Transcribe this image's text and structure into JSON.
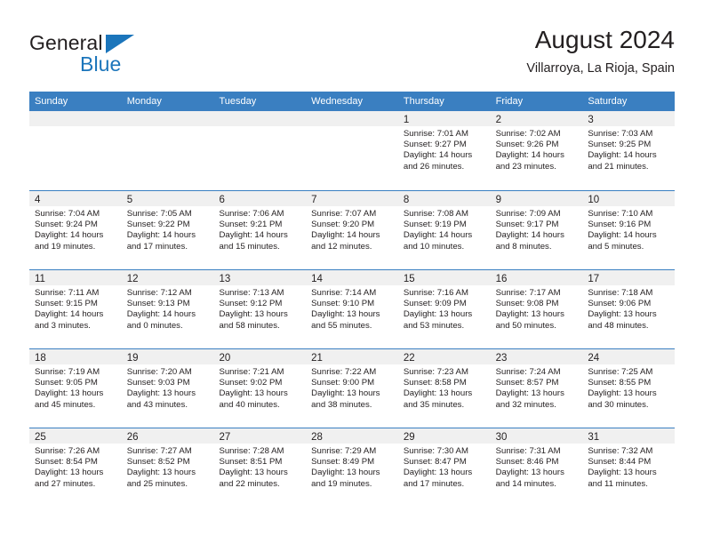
{
  "brand": {
    "name_part1": "General",
    "name_part2": "Blue",
    "triangle_icon": "triangle-icon",
    "accent_color": "#1b75bb"
  },
  "header": {
    "title": "August 2024",
    "subtitle": "Villarroya, La Rioja, Spain"
  },
  "calendar": {
    "header_color": "#3a7fc1",
    "weekday_headers": [
      "Sunday",
      "Monday",
      "Tuesday",
      "Wednesday",
      "Thursday",
      "Friday",
      "Saturday"
    ],
    "weeks": [
      [
        {
          "day": "",
          "sunrise": "",
          "sunset": "",
          "daylight_line1": "",
          "daylight_line2": "",
          "empty": true
        },
        {
          "day": "",
          "sunrise": "",
          "sunset": "",
          "daylight_line1": "",
          "daylight_line2": "",
          "empty": true
        },
        {
          "day": "",
          "sunrise": "",
          "sunset": "",
          "daylight_line1": "",
          "daylight_line2": "",
          "empty": true
        },
        {
          "day": "",
          "sunrise": "",
          "sunset": "",
          "daylight_line1": "",
          "daylight_line2": "",
          "empty": true
        },
        {
          "day": "1",
          "sunrise": "Sunrise: 7:01 AM",
          "sunset": "Sunset: 9:27 PM",
          "daylight_line1": "Daylight: 14 hours",
          "daylight_line2": "and 26 minutes."
        },
        {
          "day": "2",
          "sunrise": "Sunrise: 7:02 AM",
          "sunset": "Sunset: 9:26 PM",
          "daylight_line1": "Daylight: 14 hours",
          "daylight_line2": "and 23 minutes."
        },
        {
          "day": "3",
          "sunrise": "Sunrise: 7:03 AM",
          "sunset": "Sunset: 9:25 PM",
          "daylight_line1": "Daylight: 14 hours",
          "daylight_line2": "and 21 minutes."
        }
      ],
      [
        {
          "day": "4",
          "sunrise": "Sunrise: 7:04 AM",
          "sunset": "Sunset: 9:24 PM",
          "daylight_line1": "Daylight: 14 hours",
          "daylight_line2": "and 19 minutes."
        },
        {
          "day": "5",
          "sunrise": "Sunrise: 7:05 AM",
          "sunset": "Sunset: 9:22 PM",
          "daylight_line1": "Daylight: 14 hours",
          "daylight_line2": "and 17 minutes."
        },
        {
          "day": "6",
          "sunrise": "Sunrise: 7:06 AM",
          "sunset": "Sunset: 9:21 PM",
          "daylight_line1": "Daylight: 14 hours",
          "daylight_line2": "and 15 minutes."
        },
        {
          "day": "7",
          "sunrise": "Sunrise: 7:07 AM",
          "sunset": "Sunset: 9:20 PM",
          "daylight_line1": "Daylight: 14 hours",
          "daylight_line2": "and 12 minutes."
        },
        {
          "day": "8",
          "sunrise": "Sunrise: 7:08 AM",
          "sunset": "Sunset: 9:19 PM",
          "daylight_line1": "Daylight: 14 hours",
          "daylight_line2": "and 10 minutes."
        },
        {
          "day": "9",
          "sunrise": "Sunrise: 7:09 AM",
          "sunset": "Sunset: 9:17 PM",
          "daylight_line1": "Daylight: 14 hours",
          "daylight_line2": "and 8 minutes."
        },
        {
          "day": "10",
          "sunrise": "Sunrise: 7:10 AM",
          "sunset": "Sunset: 9:16 PM",
          "daylight_line1": "Daylight: 14 hours",
          "daylight_line2": "and 5 minutes."
        }
      ],
      [
        {
          "day": "11",
          "sunrise": "Sunrise: 7:11 AM",
          "sunset": "Sunset: 9:15 PM",
          "daylight_line1": "Daylight: 14 hours",
          "daylight_line2": "and 3 minutes."
        },
        {
          "day": "12",
          "sunrise": "Sunrise: 7:12 AM",
          "sunset": "Sunset: 9:13 PM",
          "daylight_line1": "Daylight: 14 hours",
          "daylight_line2": "and 0 minutes."
        },
        {
          "day": "13",
          "sunrise": "Sunrise: 7:13 AM",
          "sunset": "Sunset: 9:12 PM",
          "daylight_line1": "Daylight: 13 hours",
          "daylight_line2": "and 58 minutes."
        },
        {
          "day": "14",
          "sunrise": "Sunrise: 7:14 AM",
          "sunset": "Sunset: 9:10 PM",
          "daylight_line1": "Daylight: 13 hours",
          "daylight_line2": "and 55 minutes."
        },
        {
          "day": "15",
          "sunrise": "Sunrise: 7:16 AM",
          "sunset": "Sunset: 9:09 PM",
          "daylight_line1": "Daylight: 13 hours",
          "daylight_line2": "and 53 minutes."
        },
        {
          "day": "16",
          "sunrise": "Sunrise: 7:17 AM",
          "sunset": "Sunset: 9:08 PM",
          "daylight_line1": "Daylight: 13 hours",
          "daylight_line2": "and 50 minutes."
        },
        {
          "day": "17",
          "sunrise": "Sunrise: 7:18 AM",
          "sunset": "Sunset: 9:06 PM",
          "daylight_line1": "Daylight: 13 hours",
          "daylight_line2": "and 48 minutes."
        }
      ],
      [
        {
          "day": "18",
          "sunrise": "Sunrise: 7:19 AM",
          "sunset": "Sunset: 9:05 PM",
          "daylight_line1": "Daylight: 13 hours",
          "daylight_line2": "and 45 minutes."
        },
        {
          "day": "19",
          "sunrise": "Sunrise: 7:20 AM",
          "sunset": "Sunset: 9:03 PM",
          "daylight_line1": "Daylight: 13 hours",
          "daylight_line2": "and 43 minutes."
        },
        {
          "day": "20",
          "sunrise": "Sunrise: 7:21 AM",
          "sunset": "Sunset: 9:02 PM",
          "daylight_line1": "Daylight: 13 hours",
          "daylight_line2": "and 40 minutes."
        },
        {
          "day": "21",
          "sunrise": "Sunrise: 7:22 AM",
          "sunset": "Sunset: 9:00 PM",
          "daylight_line1": "Daylight: 13 hours",
          "daylight_line2": "and 38 minutes."
        },
        {
          "day": "22",
          "sunrise": "Sunrise: 7:23 AM",
          "sunset": "Sunset: 8:58 PM",
          "daylight_line1": "Daylight: 13 hours",
          "daylight_line2": "and 35 minutes."
        },
        {
          "day": "23",
          "sunrise": "Sunrise: 7:24 AM",
          "sunset": "Sunset: 8:57 PM",
          "daylight_line1": "Daylight: 13 hours",
          "daylight_line2": "and 32 minutes."
        },
        {
          "day": "24",
          "sunrise": "Sunrise: 7:25 AM",
          "sunset": "Sunset: 8:55 PM",
          "daylight_line1": "Daylight: 13 hours",
          "daylight_line2": "and 30 minutes."
        }
      ],
      [
        {
          "day": "25",
          "sunrise": "Sunrise: 7:26 AM",
          "sunset": "Sunset: 8:54 PM",
          "daylight_line1": "Daylight: 13 hours",
          "daylight_line2": "and 27 minutes."
        },
        {
          "day": "26",
          "sunrise": "Sunrise: 7:27 AM",
          "sunset": "Sunset: 8:52 PM",
          "daylight_line1": "Daylight: 13 hours",
          "daylight_line2": "and 25 minutes."
        },
        {
          "day": "27",
          "sunrise": "Sunrise: 7:28 AM",
          "sunset": "Sunset: 8:51 PM",
          "daylight_line1": "Daylight: 13 hours",
          "daylight_line2": "and 22 minutes."
        },
        {
          "day": "28",
          "sunrise": "Sunrise: 7:29 AM",
          "sunset": "Sunset: 8:49 PM",
          "daylight_line1": "Daylight: 13 hours",
          "daylight_line2": "and 19 minutes."
        },
        {
          "day": "29",
          "sunrise": "Sunrise: 7:30 AM",
          "sunset": "Sunset: 8:47 PM",
          "daylight_line1": "Daylight: 13 hours",
          "daylight_line2": "and 17 minutes."
        },
        {
          "day": "30",
          "sunrise": "Sunrise: 7:31 AM",
          "sunset": "Sunset: 8:46 PM",
          "daylight_line1": "Daylight: 13 hours",
          "daylight_line2": "and 14 minutes."
        },
        {
          "day": "31",
          "sunrise": "Sunrise: 7:32 AM",
          "sunset": "Sunset: 8:44 PM",
          "daylight_line1": "Daylight: 13 hours",
          "daylight_line2": "and 11 minutes."
        }
      ]
    ]
  }
}
